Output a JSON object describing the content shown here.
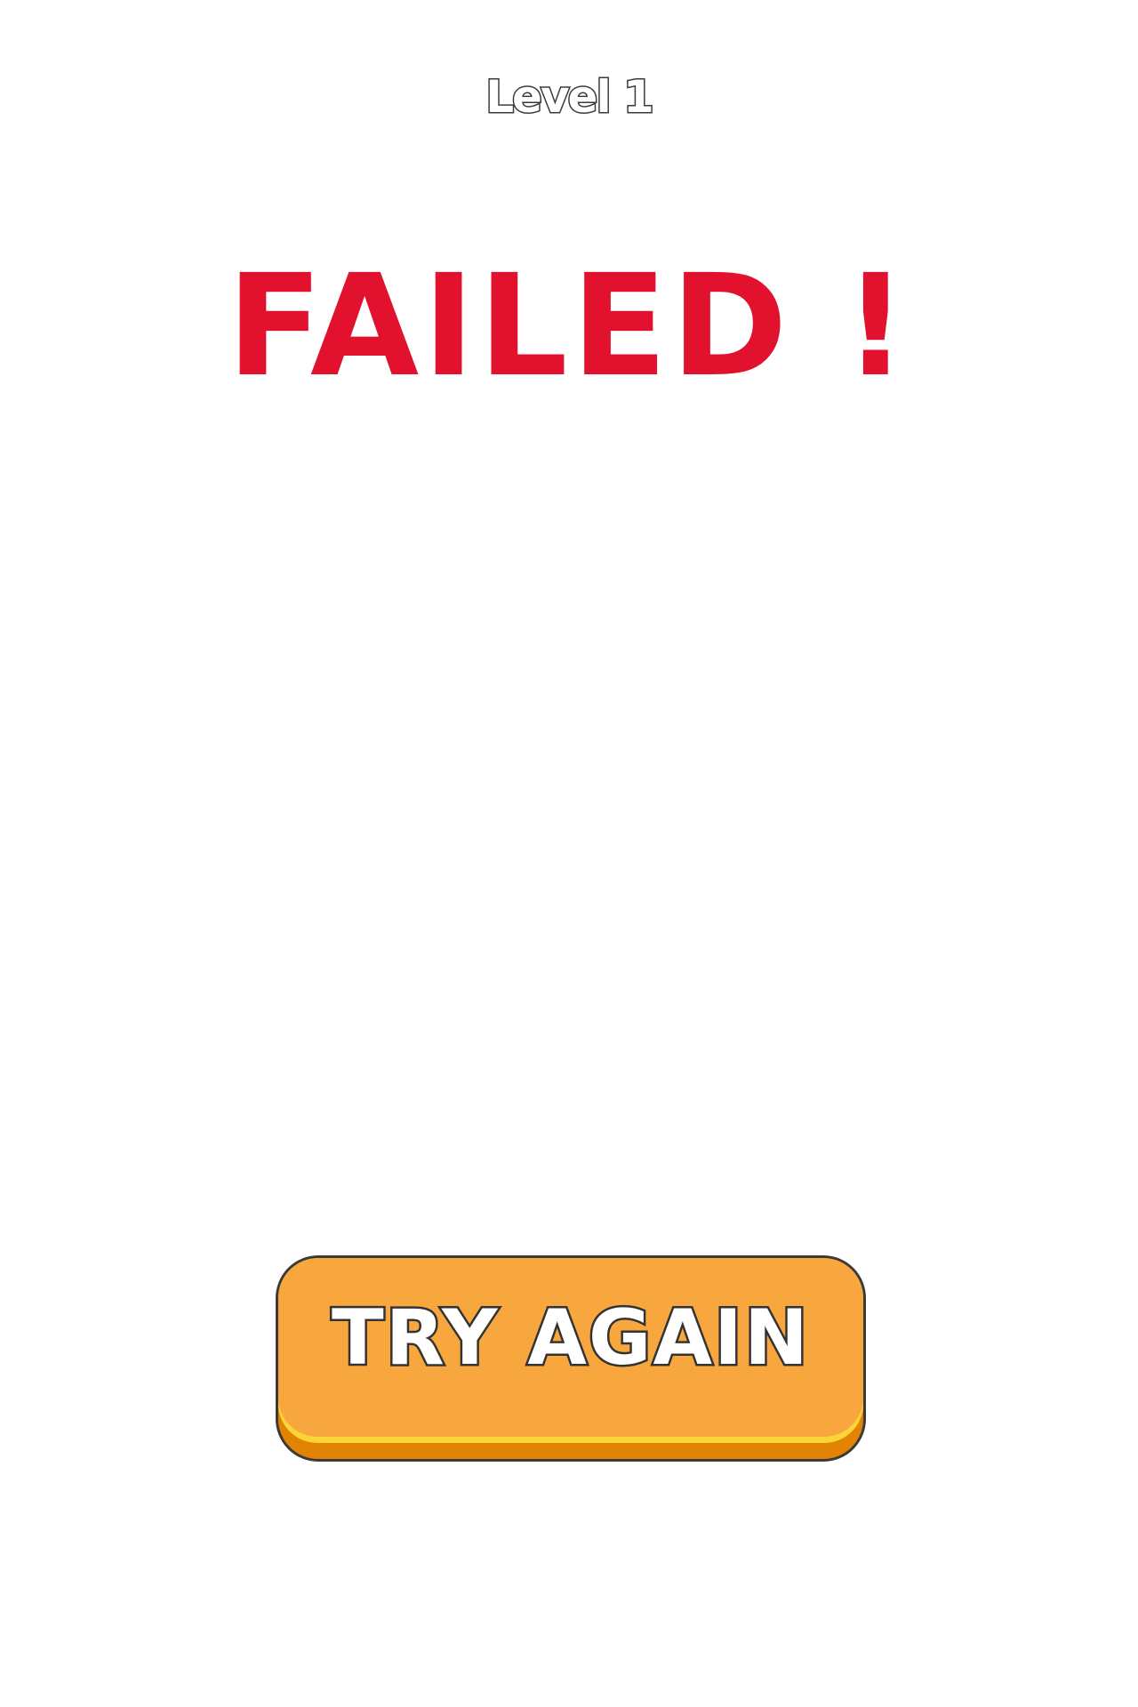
{
  "header": {
    "level_label": "Level 1"
  },
  "result": {
    "title": "FAILED !"
  },
  "actions": {
    "try_again_label": "TRY AGAIN"
  },
  "colors": {
    "background": "#ffffff",
    "failed_text": "#e2112e",
    "button_face": "#f8a73e",
    "button_highlight": "#fbd43a",
    "button_shadow": "#e38304",
    "outline": "#3a3a3a"
  }
}
